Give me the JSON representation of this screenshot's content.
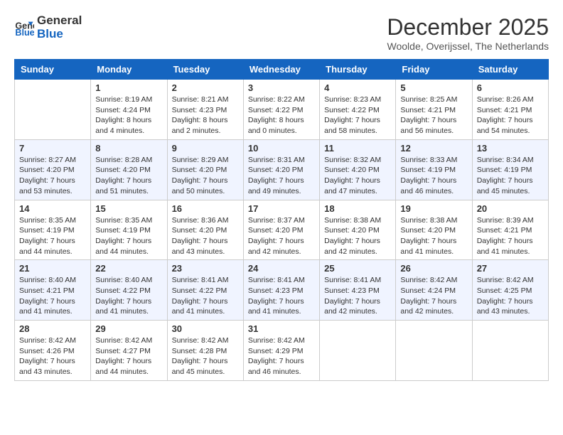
{
  "logo": {
    "line1": "General",
    "line2": "Blue"
  },
  "title": "December 2025",
  "location": "Woolde, Overijssel, The Netherlands",
  "days_of_week": [
    "Sunday",
    "Monday",
    "Tuesday",
    "Wednesday",
    "Thursday",
    "Friday",
    "Saturday"
  ],
  "weeks": [
    [
      {
        "num": "",
        "info": ""
      },
      {
        "num": "1",
        "info": "Sunrise: 8:19 AM\nSunset: 4:24 PM\nDaylight: 8 hours\nand 4 minutes."
      },
      {
        "num": "2",
        "info": "Sunrise: 8:21 AM\nSunset: 4:23 PM\nDaylight: 8 hours\nand 2 minutes."
      },
      {
        "num": "3",
        "info": "Sunrise: 8:22 AM\nSunset: 4:22 PM\nDaylight: 8 hours\nand 0 minutes."
      },
      {
        "num": "4",
        "info": "Sunrise: 8:23 AM\nSunset: 4:22 PM\nDaylight: 7 hours\nand 58 minutes."
      },
      {
        "num": "5",
        "info": "Sunrise: 8:25 AM\nSunset: 4:21 PM\nDaylight: 7 hours\nand 56 minutes."
      },
      {
        "num": "6",
        "info": "Sunrise: 8:26 AM\nSunset: 4:21 PM\nDaylight: 7 hours\nand 54 minutes."
      }
    ],
    [
      {
        "num": "7",
        "info": "Sunrise: 8:27 AM\nSunset: 4:20 PM\nDaylight: 7 hours\nand 53 minutes."
      },
      {
        "num": "8",
        "info": "Sunrise: 8:28 AM\nSunset: 4:20 PM\nDaylight: 7 hours\nand 51 minutes."
      },
      {
        "num": "9",
        "info": "Sunrise: 8:29 AM\nSunset: 4:20 PM\nDaylight: 7 hours\nand 50 minutes."
      },
      {
        "num": "10",
        "info": "Sunrise: 8:31 AM\nSunset: 4:20 PM\nDaylight: 7 hours\nand 49 minutes."
      },
      {
        "num": "11",
        "info": "Sunrise: 8:32 AM\nSunset: 4:20 PM\nDaylight: 7 hours\nand 47 minutes."
      },
      {
        "num": "12",
        "info": "Sunrise: 8:33 AM\nSunset: 4:19 PM\nDaylight: 7 hours\nand 46 minutes."
      },
      {
        "num": "13",
        "info": "Sunrise: 8:34 AM\nSunset: 4:19 PM\nDaylight: 7 hours\nand 45 minutes."
      }
    ],
    [
      {
        "num": "14",
        "info": "Sunrise: 8:35 AM\nSunset: 4:19 PM\nDaylight: 7 hours\nand 44 minutes."
      },
      {
        "num": "15",
        "info": "Sunrise: 8:35 AM\nSunset: 4:19 PM\nDaylight: 7 hours\nand 44 minutes."
      },
      {
        "num": "16",
        "info": "Sunrise: 8:36 AM\nSunset: 4:20 PM\nDaylight: 7 hours\nand 43 minutes."
      },
      {
        "num": "17",
        "info": "Sunrise: 8:37 AM\nSunset: 4:20 PM\nDaylight: 7 hours\nand 42 minutes."
      },
      {
        "num": "18",
        "info": "Sunrise: 8:38 AM\nSunset: 4:20 PM\nDaylight: 7 hours\nand 42 minutes."
      },
      {
        "num": "19",
        "info": "Sunrise: 8:38 AM\nSunset: 4:20 PM\nDaylight: 7 hours\nand 41 minutes."
      },
      {
        "num": "20",
        "info": "Sunrise: 8:39 AM\nSunset: 4:21 PM\nDaylight: 7 hours\nand 41 minutes."
      }
    ],
    [
      {
        "num": "21",
        "info": "Sunrise: 8:40 AM\nSunset: 4:21 PM\nDaylight: 7 hours\nand 41 minutes."
      },
      {
        "num": "22",
        "info": "Sunrise: 8:40 AM\nSunset: 4:22 PM\nDaylight: 7 hours\nand 41 minutes."
      },
      {
        "num": "23",
        "info": "Sunrise: 8:41 AM\nSunset: 4:22 PM\nDaylight: 7 hours\nand 41 minutes."
      },
      {
        "num": "24",
        "info": "Sunrise: 8:41 AM\nSunset: 4:23 PM\nDaylight: 7 hours\nand 41 minutes."
      },
      {
        "num": "25",
        "info": "Sunrise: 8:41 AM\nSunset: 4:23 PM\nDaylight: 7 hours\nand 42 minutes."
      },
      {
        "num": "26",
        "info": "Sunrise: 8:42 AM\nSunset: 4:24 PM\nDaylight: 7 hours\nand 42 minutes."
      },
      {
        "num": "27",
        "info": "Sunrise: 8:42 AM\nSunset: 4:25 PM\nDaylight: 7 hours\nand 43 minutes."
      }
    ],
    [
      {
        "num": "28",
        "info": "Sunrise: 8:42 AM\nSunset: 4:26 PM\nDaylight: 7 hours\nand 43 minutes."
      },
      {
        "num": "29",
        "info": "Sunrise: 8:42 AM\nSunset: 4:27 PM\nDaylight: 7 hours\nand 44 minutes."
      },
      {
        "num": "30",
        "info": "Sunrise: 8:42 AM\nSunset: 4:28 PM\nDaylight: 7 hours\nand 45 minutes."
      },
      {
        "num": "31",
        "info": "Sunrise: 8:42 AM\nSunset: 4:29 PM\nDaylight: 7 hours\nand 46 minutes."
      },
      {
        "num": "",
        "info": ""
      },
      {
        "num": "",
        "info": ""
      },
      {
        "num": "",
        "info": ""
      }
    ]
  ]
}
